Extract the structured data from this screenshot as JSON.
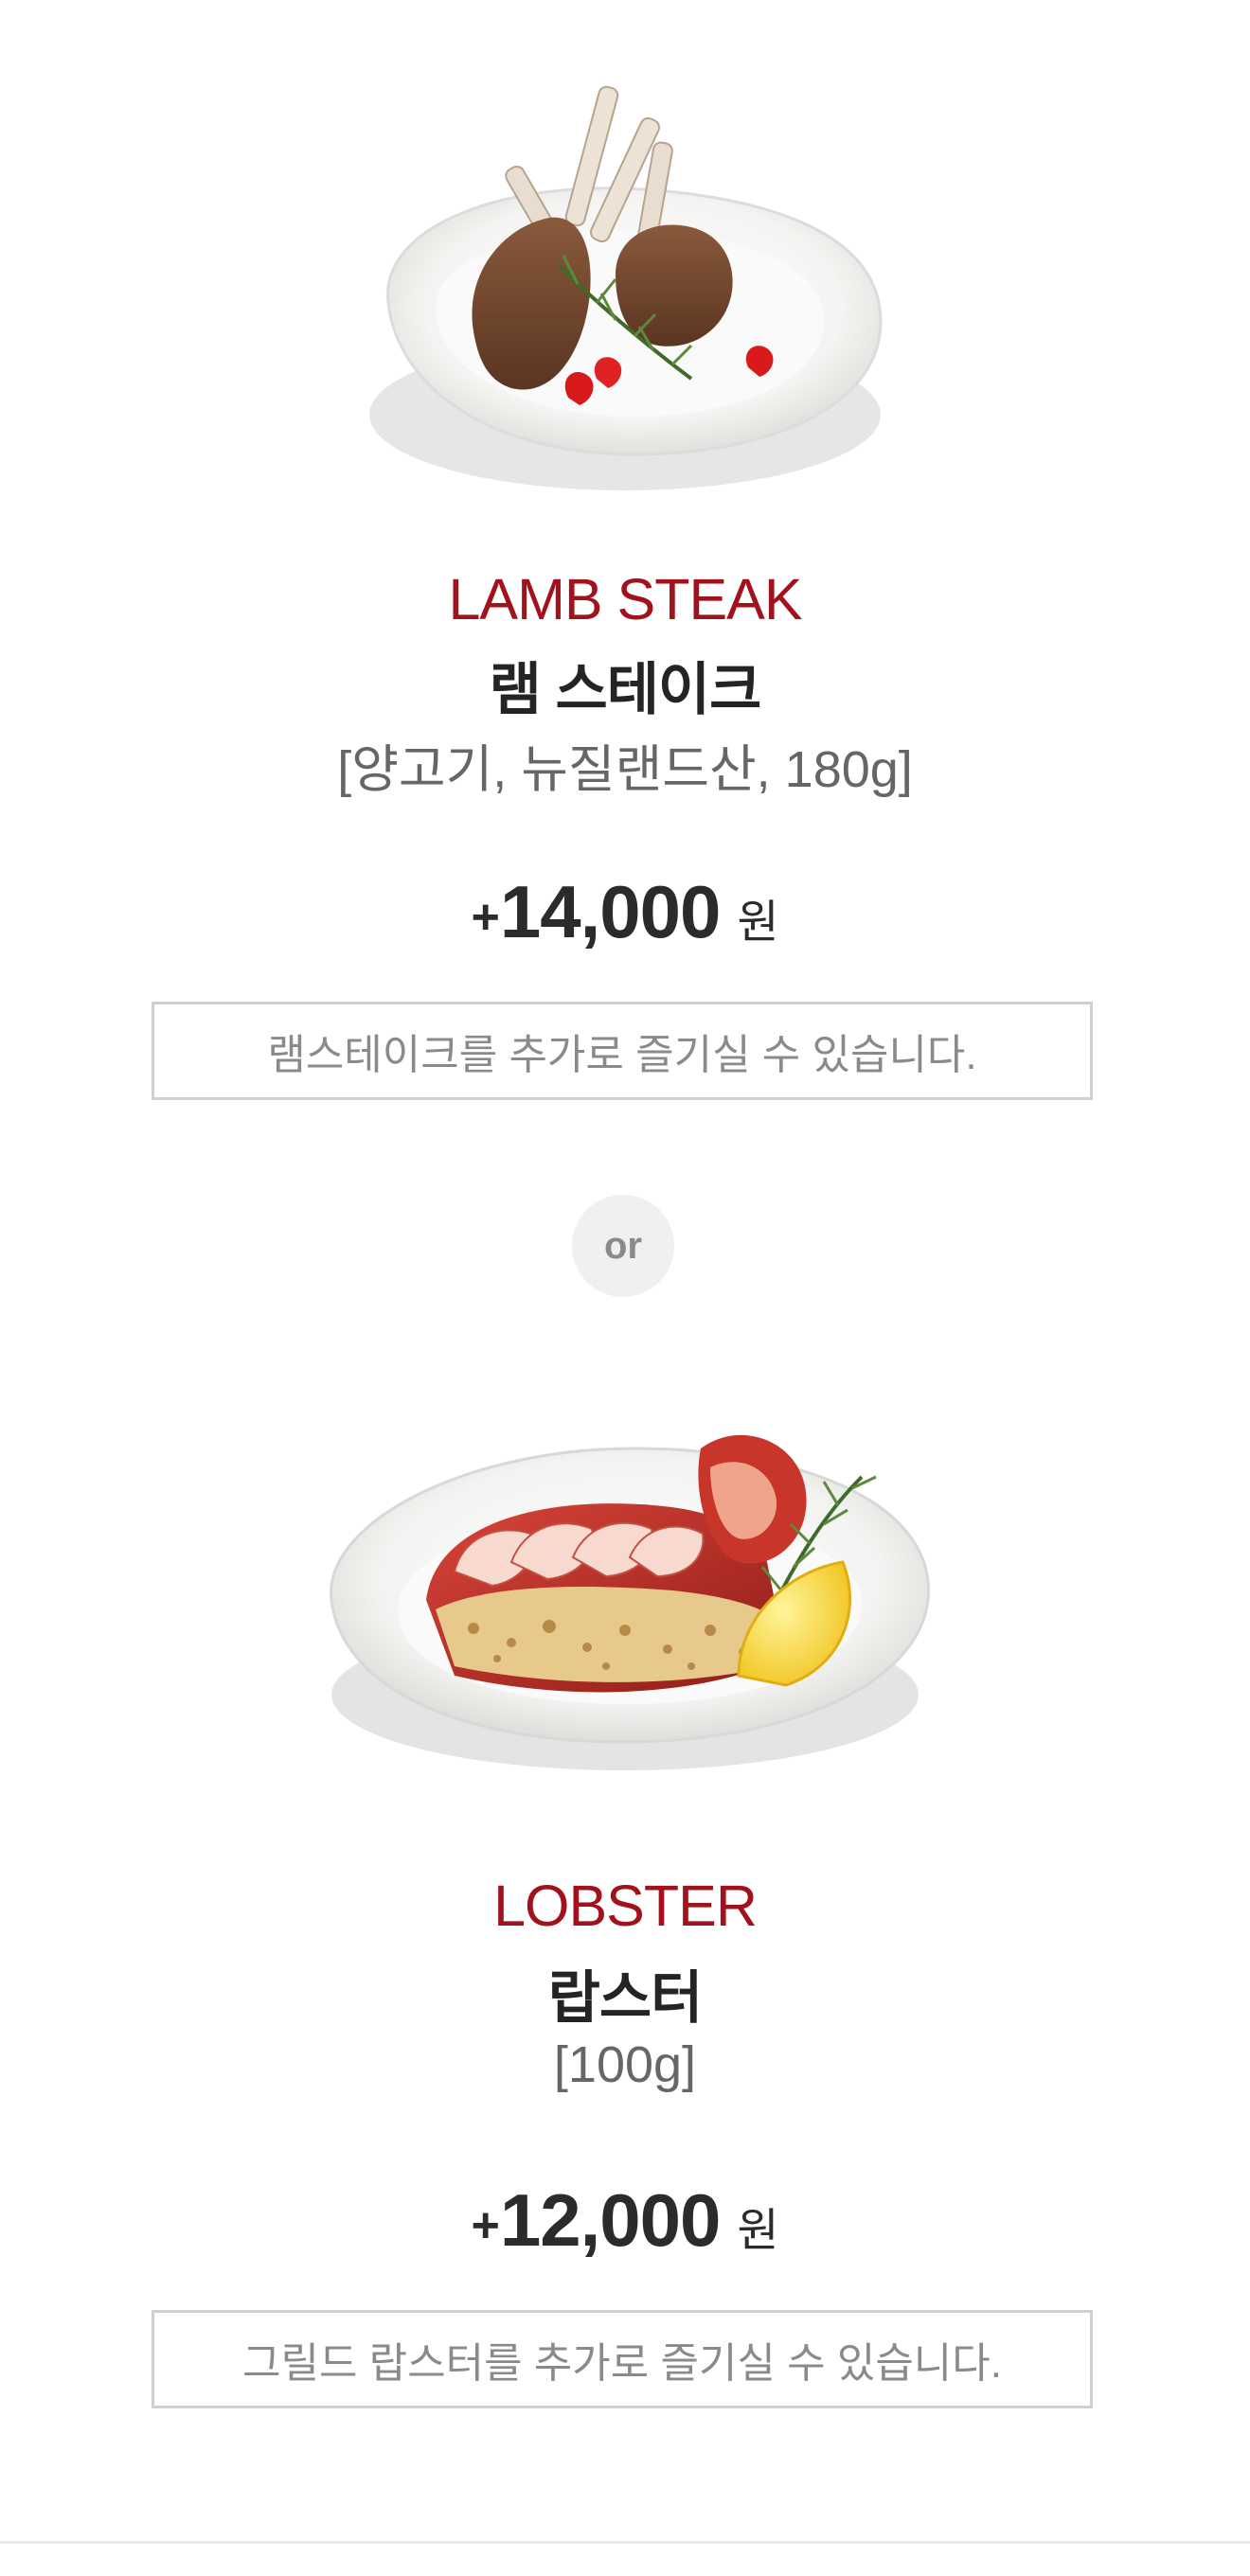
{
  "items": [
    {
      "en_name": "LAMB STEAK",
      "ko_name": "램 스테이크",
      "spec": "[양고기, 뉴질랜드산, 180g]",
      "price_prefix": "+",
      "price": "14,000",
      "currency": "원",
      "note": "램스테이크를 추가로 즐기실 수 있습니다.",
      "image_icon": "lamb-chops-plate-icon"
    },
    {
      "en_name": "LOBSTER",
      "ko_name": "랍스터",
      "spec": "[100g]",
      "price_prefix": "+",
      "price": "12,000",
      "currency": "원",
      "note": "그릴드 랍스터를 추가로 즐기실 수 있습니다.",
      "image_icon": "grilled-lobster-plate-icon"
    }
  ],
  "divider": {
    "label": "or"
  },
  "colors": {
    "accent_red": "#a1121d",
    "text_dark": "#242424",
    "text_gray": "#8a8a8a",
    "border_gray": "#cfcfcf"
  }
}
